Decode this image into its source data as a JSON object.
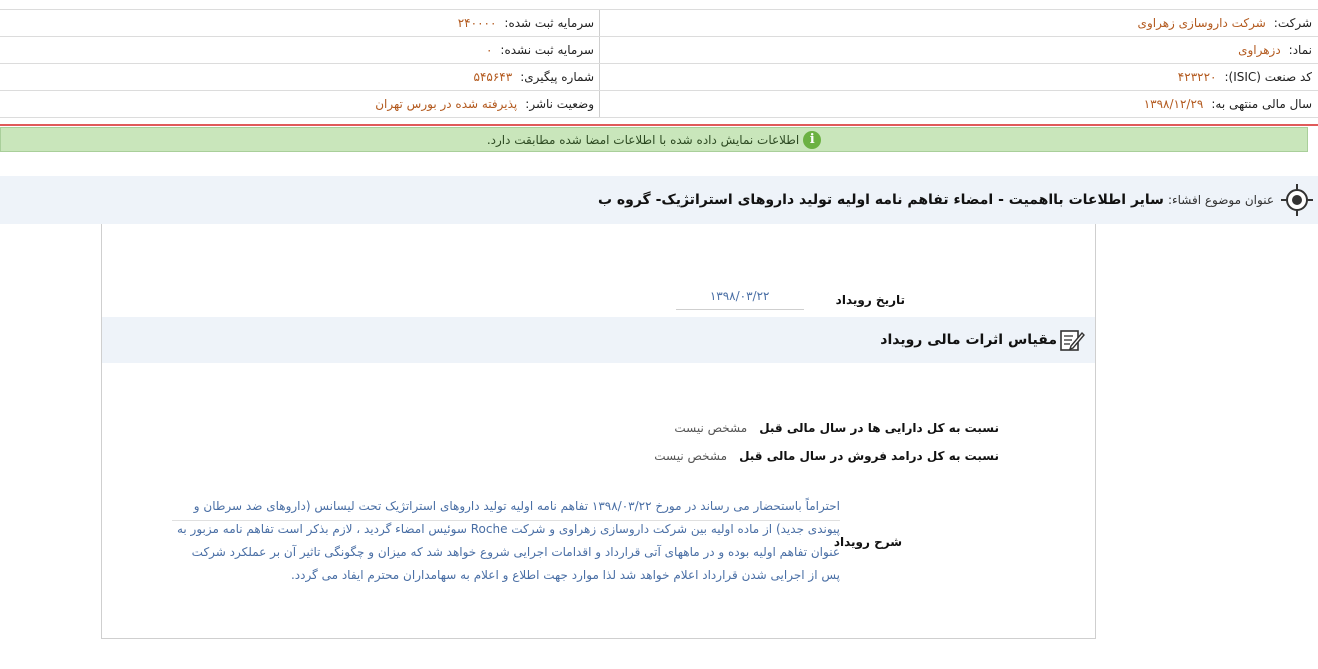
{
  "company_info": {
    "company_label": "شرکت:",
    "company_value": "شرکت داروسازی زهراوی",
    "registered_capital_label": "سرمایه ثبت شده:",
    "registered_capital_value": "۲۴۰۰۰۰",
    "symbol_label": "نماد:",
    "symbol_value": "دزهراوی",
    "unregistered_capital_label": "سرمایه ثبت نشده:",
    "unregistered_capital_value": "۰",
    "isic_label": "کد صنعت (ISIC):",
    "isic_value": "۴۲۳۲۲۰",
    "tracking_label": "شماره پیگیری:",
    "tracking_value": "۵۴۵۶۴۳",
    "fiscal_year_label": "سال مالی منتهی به:",
    "fiscal_year_value": "۱۳۹۸/۱۲/۲۹",
    "publisher_status_label": "وضعیت ناشر:",
    "publisher_status_value": "پذیرفته شده در بورس تهران"
  },
  "notice": {
    "text": "اطلاعات نمایش داده شده با اطلاعات امضا شده مطابقت دارد.",
    "icon": "info-icon",
    "icon_glyph": "i"
  },
  "title_bar": {
    "label": "عنوان موضوع افشاء:",
    "title": "سایر اطلاعات بااهمیت - امضاء تفاهم نامه اولیه تولید داروهای استراتژیک- گروه ب"
  },
  "event": {
    "date_label": "تاریخ رویداد",
    "date_value": "۱۳۹۸/۰۳/۲۲"
  },
  "financial_effects": {
    "header": "مقیاس اثرات مالی رویداد",
    "rows": [
      {
        "label": "نسبت به کل دارایی ها در سال مالی قبل",
        "value": "مشخص نیست"
      },
      {
        "label": "نسبت به کل درامد فروش در سال مالی قبل",
        "value": "مشخص نیست"
      }
    ]
  },
  "description": {
    "label": "شرح رویداد",
    "text": "احتراماً باستحضار می رساند در مورخ ۱۳۹۸/۰۳/۲۲ تفاهم نامه اولیه تولید داروهای استراتژیک تحت لیسانس (داروهای ضد سرطان و پیوندی جدید) از ماده اولیه بین شرکت داروسازی زهراوی و شرکت Roche سوئیس امضاء گردید ، لازم بذکر است تفاهم نامه مزبور به عنوان تفاهم اولیه بوده و در ماههای آتی قرارداد و اقدامات اجرایی شروع خواهد شد که میزان و چگونگی تاثیر آن بر عملکرد شرکت پس از اجرایی شدن قرارداد اعلام خواهد شد لذا موارد جهت اطلاع و اعلام به سهامداران محترم ایفاد می گردد."
  },
  "colors": {
    "value_text": "#b35a1f",
    "notice_bg": "#c9e6bb",
    "link_blue": "#4a6fa5",
    "title_bg": "#eef3f9"
  }
}
